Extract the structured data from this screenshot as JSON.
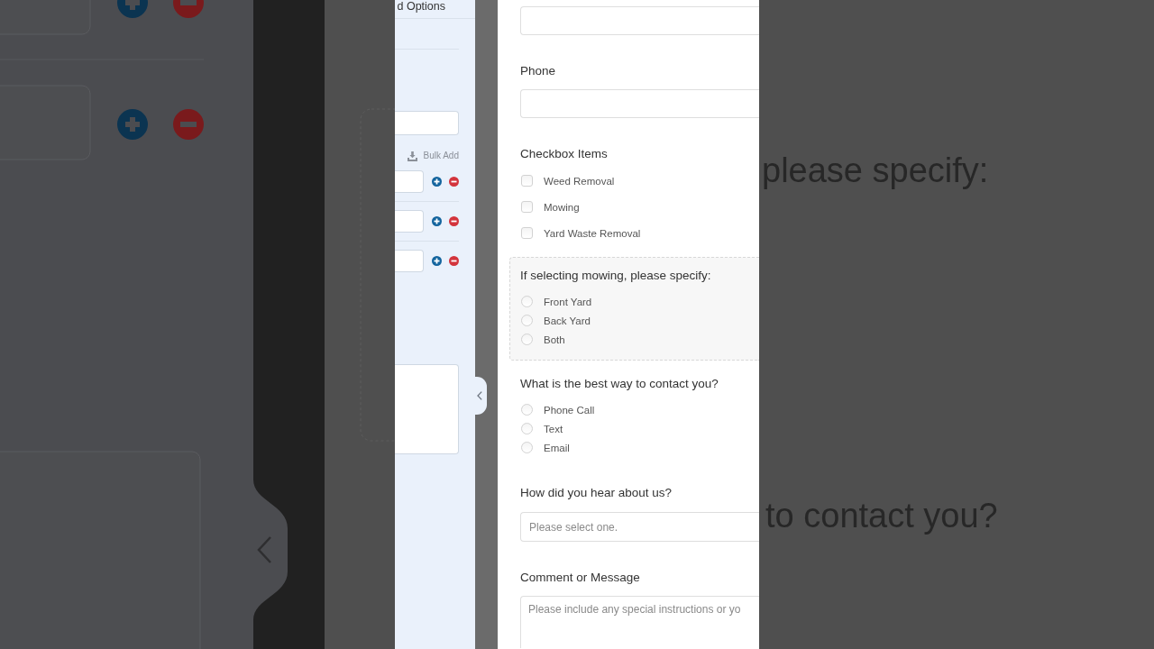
{
  "options_panel": {
    "title": "d Options",
    "bulk_add": "Bulk Add",
    "option_rows": [
      {
        "kind": "option"
      },
      {
        "kind": "option"
      },
      {
        "kind": "option"
      }
    ]
  },
  "form": {
    "fields": [
      {
        "kind": "text"
      },
      {
        "kind": "text",
        "label": "Phone"
      },
      {
        "kind": "checkboxes",
        "label": "Checkbox Items",
        "options": [
          {
            "label": "Weed Removal",
            "checked": false
          },
          {
            "label": "Mowing",
            "checked": false
          },
          {
            "label": "Yard Waste Removal",
            "checked": false
          }
        ]
      },
      {
        "kind": "radios",
        "label": "If selecting mowing, please specify:",
        "conditional": true,
        "options": [
          {
            "label": "Front Yard",
            "selected": false
          },
          {
            "label": "Back Yard",
            "selected": false
          },
          {
            "label": "Both",
            "selected": false
          }
        ]
      },
      {
        "kind": "radios",
        "label": "What is the best way to contact you?",
        "conditional": false,
        "options": [
          {
            "label": "Phone Call",
            "selected": false
          },
          {
            "label": "Text",
            "selected": false
          },
          {
            "label": "Email",
            "selected": false
          }
        ]
      },
      {
        "kind": "select",
        "label": "How did you hear about us?",
        "placeholder": "Please select one."
      },
      {
        "kind": "textarea",
        "label": "Comment or Message",
        "placeholder": "Please include any special instructions or yo"
      }
    ]
  },
  "backdrop": {
    "texts": [
      "please specify:",
      "to contact you?"
    ]
  }
}
